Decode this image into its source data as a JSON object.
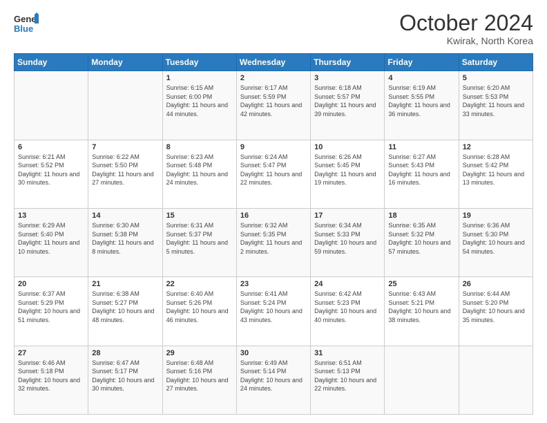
{
  "logo": {
    "general": "General",
    "blue": "Blue"
  },
  "title": {
    "month": "October 2024",
    "location": "Kwirak, North Korea"
  },
  "weekdays": [
    "Sunday",
    "Monday",
    "Tuesday",
    "Wednesday",
    "Thursday",
    "Friday",
    "Saturday"
  ],
  "weeks": [
    [
      {
        "day": "",
        "sunrise": "",
        "sunset": "",
        "daylight": ""
      },
      {
        "day": "",
        "sunrise": "",
        "sunset": "",
        "daylight": ""
      },
      {
        "day": "1",
        "sunrise": "Sunrise: 6:15 AM",
        "sunset": "Sunset: 6:00 PM",
        "daylight": "Daylight: 11 hours and 44 minutes."
      },
      {
        "day": "2",
        "sunrise": "Sunrise: 6:17 AM",
        "sunset": "Sunset: 5:59 PM",
        "daylight": "Daylight: 11 hours and 42 minutes."
      },
      {
        "day": "3",
        "sunrise": "Sunrise: 6:18 AM",
        "sunset": "Sunset: 5:57 PM",
        "daylight": "Daylight: 11 hours and 39 minutes."
      },
      {
        "day": "4",
        "sunrise": "Sunrise: 6:19 AM",
        "sunset": "Sunset: 5:55 PM",
        "daylight": "Daylight: 11 hours and 36 minutes."
      },
      {
        "day": "5",
        "sunrise": "Sunrise: 6:20 AM",
        "sunset": "Sunset: 5:53 PM",
        "daylight": "Daylight: 11 hours and 33 minutes."
      }
    ],
    [
      {
        "day": "6",
        "sunrise": "Sunrise: 6:21 AM",
        "sunset": "Sunset: 5:52 PM",
        "daylight": "Daylight: 11 hours and 30 minutes."
      },
      {
        "day": "7",
        "sunrise": "Sunrise: 6:22 AM",
        "sunset": "Sunset: 5:50 PM",
        "daylight": "Daylight: 11 hours and 27 minutes."
      },
      {
        "day": "8",
        "sunrise": "Sunrise: 6:23 AM",
        "sunset": "Sunset: 5:48 PM",
        "daylight": "Daylight: 11 hours and 24 minutes."
      },
      {
        "day": "9",
        "sunrise": "Sunrise: 6:24 AM",
        "sunset": "Sunset: 5:47 PM",
        "daylight": "Daylight: 11 hours and 22 minutes."
      },
      {
        "day": "10",
        "sunrise": "Sunrise: 6:26 AM",
        "sunset": "Sunset: 5:45 PM",
        "daylight": "Daylight: 11 hours and 19 minutes."
      },
      {
        "day": "11",
        "sunrise": "Sunrise: 6:27 AM",
        "sunset": "Sunset: 5:43 PM",
        "daylight": "Daylight: 11 hours and 16 minutes."
      },
      {
        "day": "12",
        "sunrise": "Sunrise: 6:28 AM",
        "sunset": "Sunset: 5:42 PM",
        "daylight": "Daylight: 11 hours and 13 minutes."
      }
    ],
    [
      {
        "day": "13",
        "sunrise": "Sunrise: 6:29 AM",
        "sunset": "Sunset: 5:40 PM",
        "daylight": "Daylight: 11 hours and 10 minutes."
      },
      {
        "day": "14",
        "sunrise": "Sunrise: 6:30 AM",
        "sunset": "Sunset: 5:38 PM",
        "daylight": "Daylight: 11 hours and 8 minutes."
      },
      {
        "day": "15",
        "sunrise": "Sunrise: 6:31 AM",
        "sunset": "Sunset: 5:37 PM",
        "daylight": "Daylight: 11 hours and 5 minutes."
      },
      {
        "day": "16",
        "sunrise": "Sunrise: 6:32 AM",
        "sunset": "Sunset: 5:35 PM",
        "daylight": "Daylight: 11 hours and 2 minutes."
      },
      {
        "day": "17",
        "sunrise": "Sunrise: 6:34 AM",
        "sunset": "Sunset: 5:33 PM",
        "daylight": "Daylight: 10 hours and 59 minutes."
      },
      {
        "day": "18",
        "sunrise": "Sunrise: 6:35 AM",
        "sunset": "Sunset: 5:32 PM",
        "daylight": "Daylight: 10 hours and 57 minutes."
      },
      {
        "day": "19",
        "sunrise": "Sunrise: 6:36 AM",
        "sunset": "Sunset: 5:30 PM",
        "daylight": "Daylight: 10 hours and 54 minutes."
      }
    ],
    [
      {
        "day": "20",
        "sunrise": "Sunrise: 6:37 AM",
        "sunset": "Sunset: 5:29 PM",
        "daylight": "Daylight: 10 hours and 51 minutes."
      },
      {
        "day": "21",
        "sunrise": "Sunrise: 6:38 AM",
        "sunset": "Sunset: 5:27 PM",
        "daylight": "Daylight: 10 hours and 48 minutes."
      },
      {
        "day": "22",
        "sunrise": "Sunrise: 6:40 AM",
        "sunset": "Sunset: 5:26 PM",
        "daylight": "Daylight: 10 hours and 46 minutes."
      },
      {
        "day": "23",
        "sunrise": "Sunrise: 6:41 AM",
        "sunset": "Sunset: 5:24 PM",
        "daylight": "Daylight: 10 hours and 43 minutes."
      },
      {
        "day": "24",
        "sunrise": "Sunrise: 6:42 AM",
        "sunset": "Sunset: 5:23 PM",
        "daylight": "Daylight: 10 hours and 40 minutes."
      },
      {
        "day": "25",
        "sunrise": "Sunrise: 6:43 AM",
        "sunset": "Sunset: 5:21 PM",
        "daylight": "Daylight: 10 hours and 38 minutes."
      },
      {
        "day": "26",
        "sunrise": "Sunrise: 6:44 AM",
        "sunset": "Sunset: 5:20 PM",
        "daylight": "Daylight: 10 hours and 35 minutes."
      }
    ],
    [
      {
        "day": "27",
        "sunrise": "Sunrise: 6:46 AM",
        "sunset": "Sunset: 5:18 PM",
        "daylight": "Daylight: 10 hours and 32 minutes."
      },
      {
        "day": "28",
        "sunrise": "Sunrise: 6:47 AM",
        "sunset": "Sunset: 5:17 PM",
        "daylight": "Daylight: 10 hours and 30 minutes."
      },
      {
        "day": "29",
        "sunrise": "Sunrise: 6:48 AM",
        "sunset": "Sunset: 5:16 PM",
        "daylight": "Daylight: 10 hours and 27 minutes."
      },
      {
        "day": "30",
        "sunrise": "Sunrise: 6:49 AM",
        "sunset": "Sunset: 5:14 PM",
        "daylight": "Daylight: 10 hours and 24 minutes."
      },
      {
        "day": "31",
        "sunrise": "Sunrise: 6:51 AM",
        "sunset": "Sunset: 5:13 PM",
        "daylight": "Daylight: 10 hours and 22 minutes."
      },
      {
        "day": "",
        "sunrise": "",
        "sunset": "",
        "daylight": ""
      },
      {
        "day": "",
        "sunrise": "",
        "sunset": "",
        "daylight": ""
      }
    ]
  ]
}
